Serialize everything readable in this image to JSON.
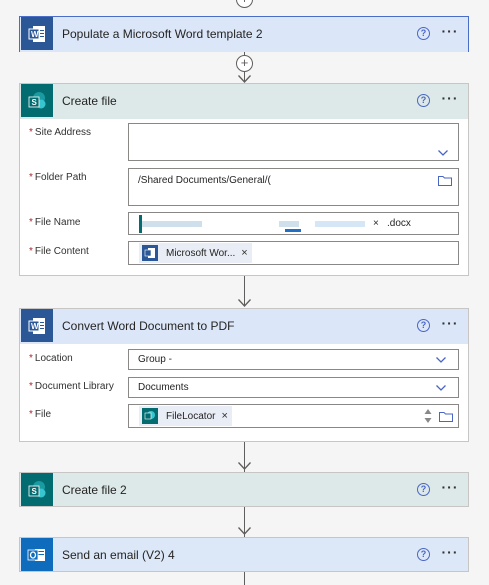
{
  "steps": {
    "populate": {
      "title": "Populate a Microsoft Word template 2"
    },
    "create_file": {
      "title": "Create file",
      "fields": {
        "site_address": {
          "label": "Site Address",
          "value": ""
        },
        "folder_path": {
          "label": "Folder Path",
          "value": "/Shared Documents/General/("
        },
        "file_name": {
          "label": "File Name",
          "suffix": ".docx"
        },
        "file_content": {
          "label": "File Content",
          "token": "Microsoft Wor..."
        }
      }
    },
    "convert": {
      "title": "Convert Word Document to PDF",
      "fields": {
        "location": {
          "label": "Location",
          "value": "Group -"
        },
        "document_library": {
          "label": "Document Library",
          "value": "Documents"
        },
        "file": {
          "label": "File",
          "token": "FileLocator"
        }
      }
    },
    "create_file_2": {
      "title": "Create file 2"
    },
    "send_email": {
      "title": "Send an email (V2) 4"
    }
  },
  "common": {
    "help_glyph": "?",
    "more_glyph": "···",
    "remove_glyph": "×",
    "add_glyph": "+",
    "required_mark": "*"
  },
  "colors": {
    "word_blue": "#2b5797",
    "sharepoint_teal": "#036c70",
    "outlook_blue": "#0f6cbd",
    "link_blue": "#4a66c4",
    "required_red": "#a4262c"
  }
}
